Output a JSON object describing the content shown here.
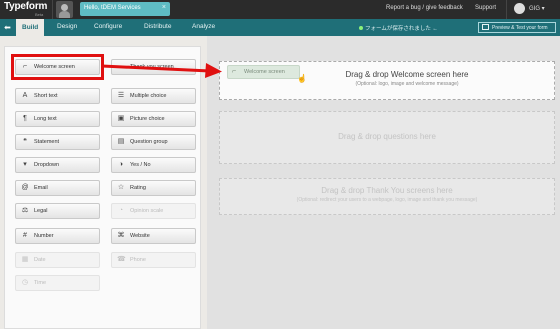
{
  "topbar": {
    "logo": "Typeform",
    "logo_sub": "Beta",
    "form_tab": "Hello, tDEM Services",
    "close_symbol": "×",
    "report_link": "Report a bug / give feedback",
    "support_link": "Support",
    "user_name": "GIG ▾"
  },
  "nav": {
    "home_symbol": "⬅",
    "tabs": [
      "Build",
      "Design",
      "Configure",
      "Distribute",
      "Analyze"
    ],
    "active_tab": "Build",
    "status": "フォームが保存されました ←",
    "preview": "Preview & Test your form"
  },
  "left_panel": {
    "welcome_button": "Welcome screen",
    "thankyou_button": "Thank you screen",
    "questions": [
      {
        "label": "Short text",
        "icon": "A"
      },
      {
        "label": "Multiple choice",
        "icon": "☰"
      },
      {
        "label": "Long text",
        "icon": "¶"
      },
      {
        "label": "Picture choice",
        "icon": "▣"
      },
      {
        "label": "Statement",
        "icon": "❝"
      },
      {
        "label": "Question group",
        "icon": "▤"
      },
      {
        "label": "Dropdown",
        "icon": "▾"
      },
      {
        "label": "Yes / No",
        "icon": "◑"
      },
      {
        "label": "Email",
        "icon": "@"
      },
      {
        "label": "Rating",
        "icon": "☆"
      },
      {
        "label": "Legal",
        "icon": "⚖"
      },
      {
        "label": "Opinion scale",
        "icon": "◔"
      },
      {
        "label": "Number",
        "icon": "#"
      },
      {
        "label": "Website",
        "icon": "⌘"
      },
      {
        "label": "Date",
        "icon": "▦"
      },
      {
        "label": "Phone",
        "icon": "☎"
      },
      {
        "label": "Time",
        "icon": "◷"
      }
    ]
  },
  "canvas": {
    "ghost_label": "Welcome screen",
    "welcome_drop_title": "Drag & drop Welcome screen here",
    "welcome_drop_sub": "(Optional: logo, image and welcome message)",
    "questions_drop_title": "Drag & drop questions here",
    "thankyou_drop_title": "Drag & drop Thank You screens here",
    "thankyou_drop_sub": "(Optional: redirect your users to a webpage, logo, image and thank you message)"
  },
  "colors": {
    "topbar": "#2b2b2b",
    "navbar": "#1f6f78",
    "form_tab": "#5fbcc4",
    "highlight": "#e01010"
  }
}
